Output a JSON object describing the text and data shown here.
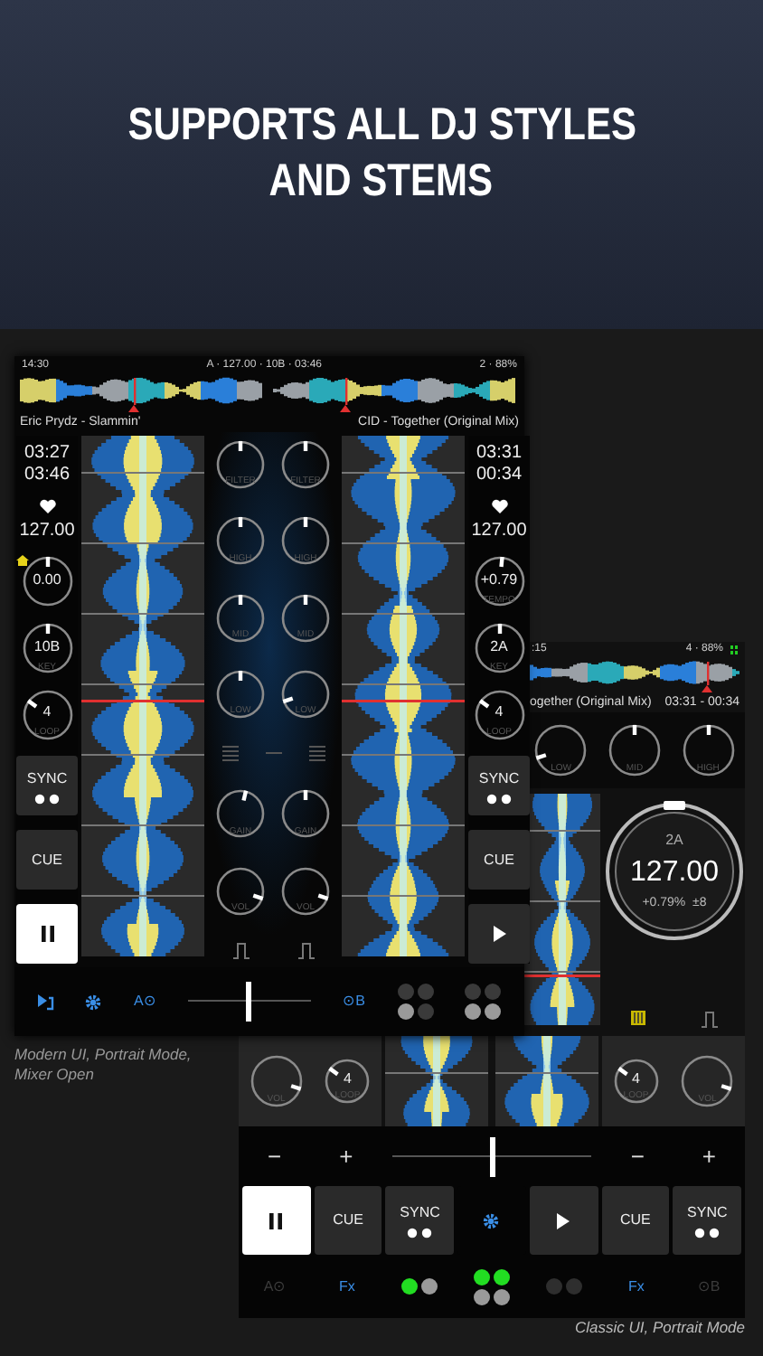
{
  "headline": {
    "lines": [
      "SUPPORTS ALL DJ STYLES",
      "AND STEMS"
    ]
  },
  "modern_screen": {
    "status_bar": {
      "time": "14:30",
      "deck_info": "A · 127.00 · 10B · 03:46",
      "battery": "2 · 88%"
    },
    "decks": [
      {
        "title": "Eric Prydz - Slammin'",
        "elapsed": "03:27",
        "remaining": "03:46",
        "bpm": "127.00",
        "knobs": [
          {
            "value": "0.00",
            "home": true,
            "level": 0.5
          },
          {
            "value": "10B",
            "label": "KEY",
            "level": 0.5
          },
          {
            "value": "4",
            "label": "LOOP",
            "level": 0.3
          }
        ],
        "sync": "SYNC",
        "cue": "CUE",
        "transport": {
          "kind": "pause",
          "active": true
        }
      },
      {
        "title": "CID - Together (Original Mix)",
        "elapsed": "03:31",
        "remaining": "00:34",
        "bpm": "127.00",
        "knobs": [
          {
            "value": "+0.79",
            "label": "TEMPO",
            "level": 0.52
          },
          {
            "value": "2A",
            "label": "KEY",
            "level": 0.5
          },
          {
            "value": "4",
            "label": "LOOP",
            "level": 0.3
          }
        ],
        "sync": "SYNC",
        "cue": "CUE",
        "transport": {
          "kind": "play",
          "active": false
        }
      }
    ],
    "mixer": [
      {
        "eq": [
          {
            "label": "FILTER",
            "level": 0.5
          },
          {
            "label": "HIGH",
            "level": 0.5
          },
          {
            "label": "MID",
            "level": 0.5
          },
          {
            "label": "LOW",
            "level": 0.5
          }
        ],
        "gain": {
          "label": "GAIN",
          "level": 0.55
        },
        "volume": {
          "label": "VOL",
          "level": 0.9
        }
      },
      {
        "eq": [
          {
            "label": "FILTER",
            "level": 0.5
          },
          {
            "label": "HIGH",
            "level": 0.5
          },
          {
            "label": "MID",
            "level": 0.5
          },
          {
            "label": "LOW",
            "level": 0.1
          }
        ],
        "gain": {
          "label": "GAIN",
          "level": 0.5
        },
        "volume": {
          "label": "VOL",
          "level": 0.9
        }
      }
    ],
    "crossfader": {
      "left": "A⊙",
      "right": "⊙B",
      "level": 0.5
    },
    "pad_groups": [
      {
        "dots": [
          {
            "color": "#3a3a3a"
          },
          {
            "color": "#3a3a3a"
          },
          {
            "color": "#9a9a9a"
          },
          {
            "color": "#3a3a3a"
          }
        ]
      },
      {
        "dots": [
          {
            "color": "#3a3a3a"
          },
          {
            "color": "#3a3a3a"
          },
          {
            "color": "#9a9a9a"
          },
          {
            "color": "#9a9a9a"
          }
        ]
      }
    ]
  },
  "modern_caption": "Modern UI, Portrait Mode, Mixer Open",
  "classic_screen": {
    "status_bar": {
      "time": ":15",
      "battery": "4 · 88%"
    },
    "title": "ogether (Original Mix)",
    "time": "03:31 - 00:34",
    "eq": [
      {
        "label": "LOW",
        "level": 0.1
      },
      {
        "label": "MID",
        "level": 0.5
      },
      {
        "label": "HIGH",
        "level": 0.5
      }
    ],
    "deck_display": {
      "key": "2A",
      "bpm": "127.00",
      "pitch": "+0.79%",
      "range": "±8"
    },
    "lower_knobs": [
      {
        "label": "VOL",
        "level": 0.9
      },
      {
        "value": "4",
        "label": "LOOP",
        "level": 0.3
      },
      {
        "value": "4",
        "label": "LOOP",
        "level": 0.3
      },
      {
        "label": "VOL",
        "level": 0.9
      }
    ],
    "pitch_controls": [
      {
        "minus": "−",
        "plus": "+"
      },
      {
        "minus": "−",
        "plus": "+"
      }
    ],
    "crossfader": {
      "level": 0.5
    },
    "buttons": [
      {
        "kind": "pause",
        "active": true
      },
      {
        "kind": "text",
        "label": "CUE"
      },
      {
        "kind": "sync",
        "label": "SYNC"
      },
      {
        "kind": "gear"
      },
      {
        "kind": "play",
        "active": false
      },
      {
        "kind": "text",
        "label": "CUE"
      },
      {
        "kind": "sync",
        "label": "SYNC"
      }
    ],
    "bottom_row": [
      {
        "kind": "text",
        "label": "A⊙",
        "disabled": true
      },
      {
        "kind": "text",
        "label": "Fx",
        "disabled": false
      },
      {
        "kind": "dots",
        "dots": [
          {
            "color": "#22dd22"
          },
          {
            "color": "#9a9a9a"
          }
        ]
      },
      {
        "kind": "dots",
        "dots": [
          {
            "color": "#22dd22"
          },
          {
            "color": "#22dd22"
          },
          {
            "color": "#9a9a9a"
          },
          {
            "color": "#9a9a9a"
          }
        ]
      },
      {
        "kind": "dots",
        "dots": [
          {
            "color": "#2e2e2e"
          },
          {
            "color": "#2e2e2e"
          }
        ]
      },
      {
        "kind": "text",
        "label": "Fx",
        "disabled": false
      },
      {
        "kind": "text",
        "label": "⊙B",
        "disabled": true
      }
    ]
  },
  "classic_caption": "Classic UI, Portrait Mode"
}
